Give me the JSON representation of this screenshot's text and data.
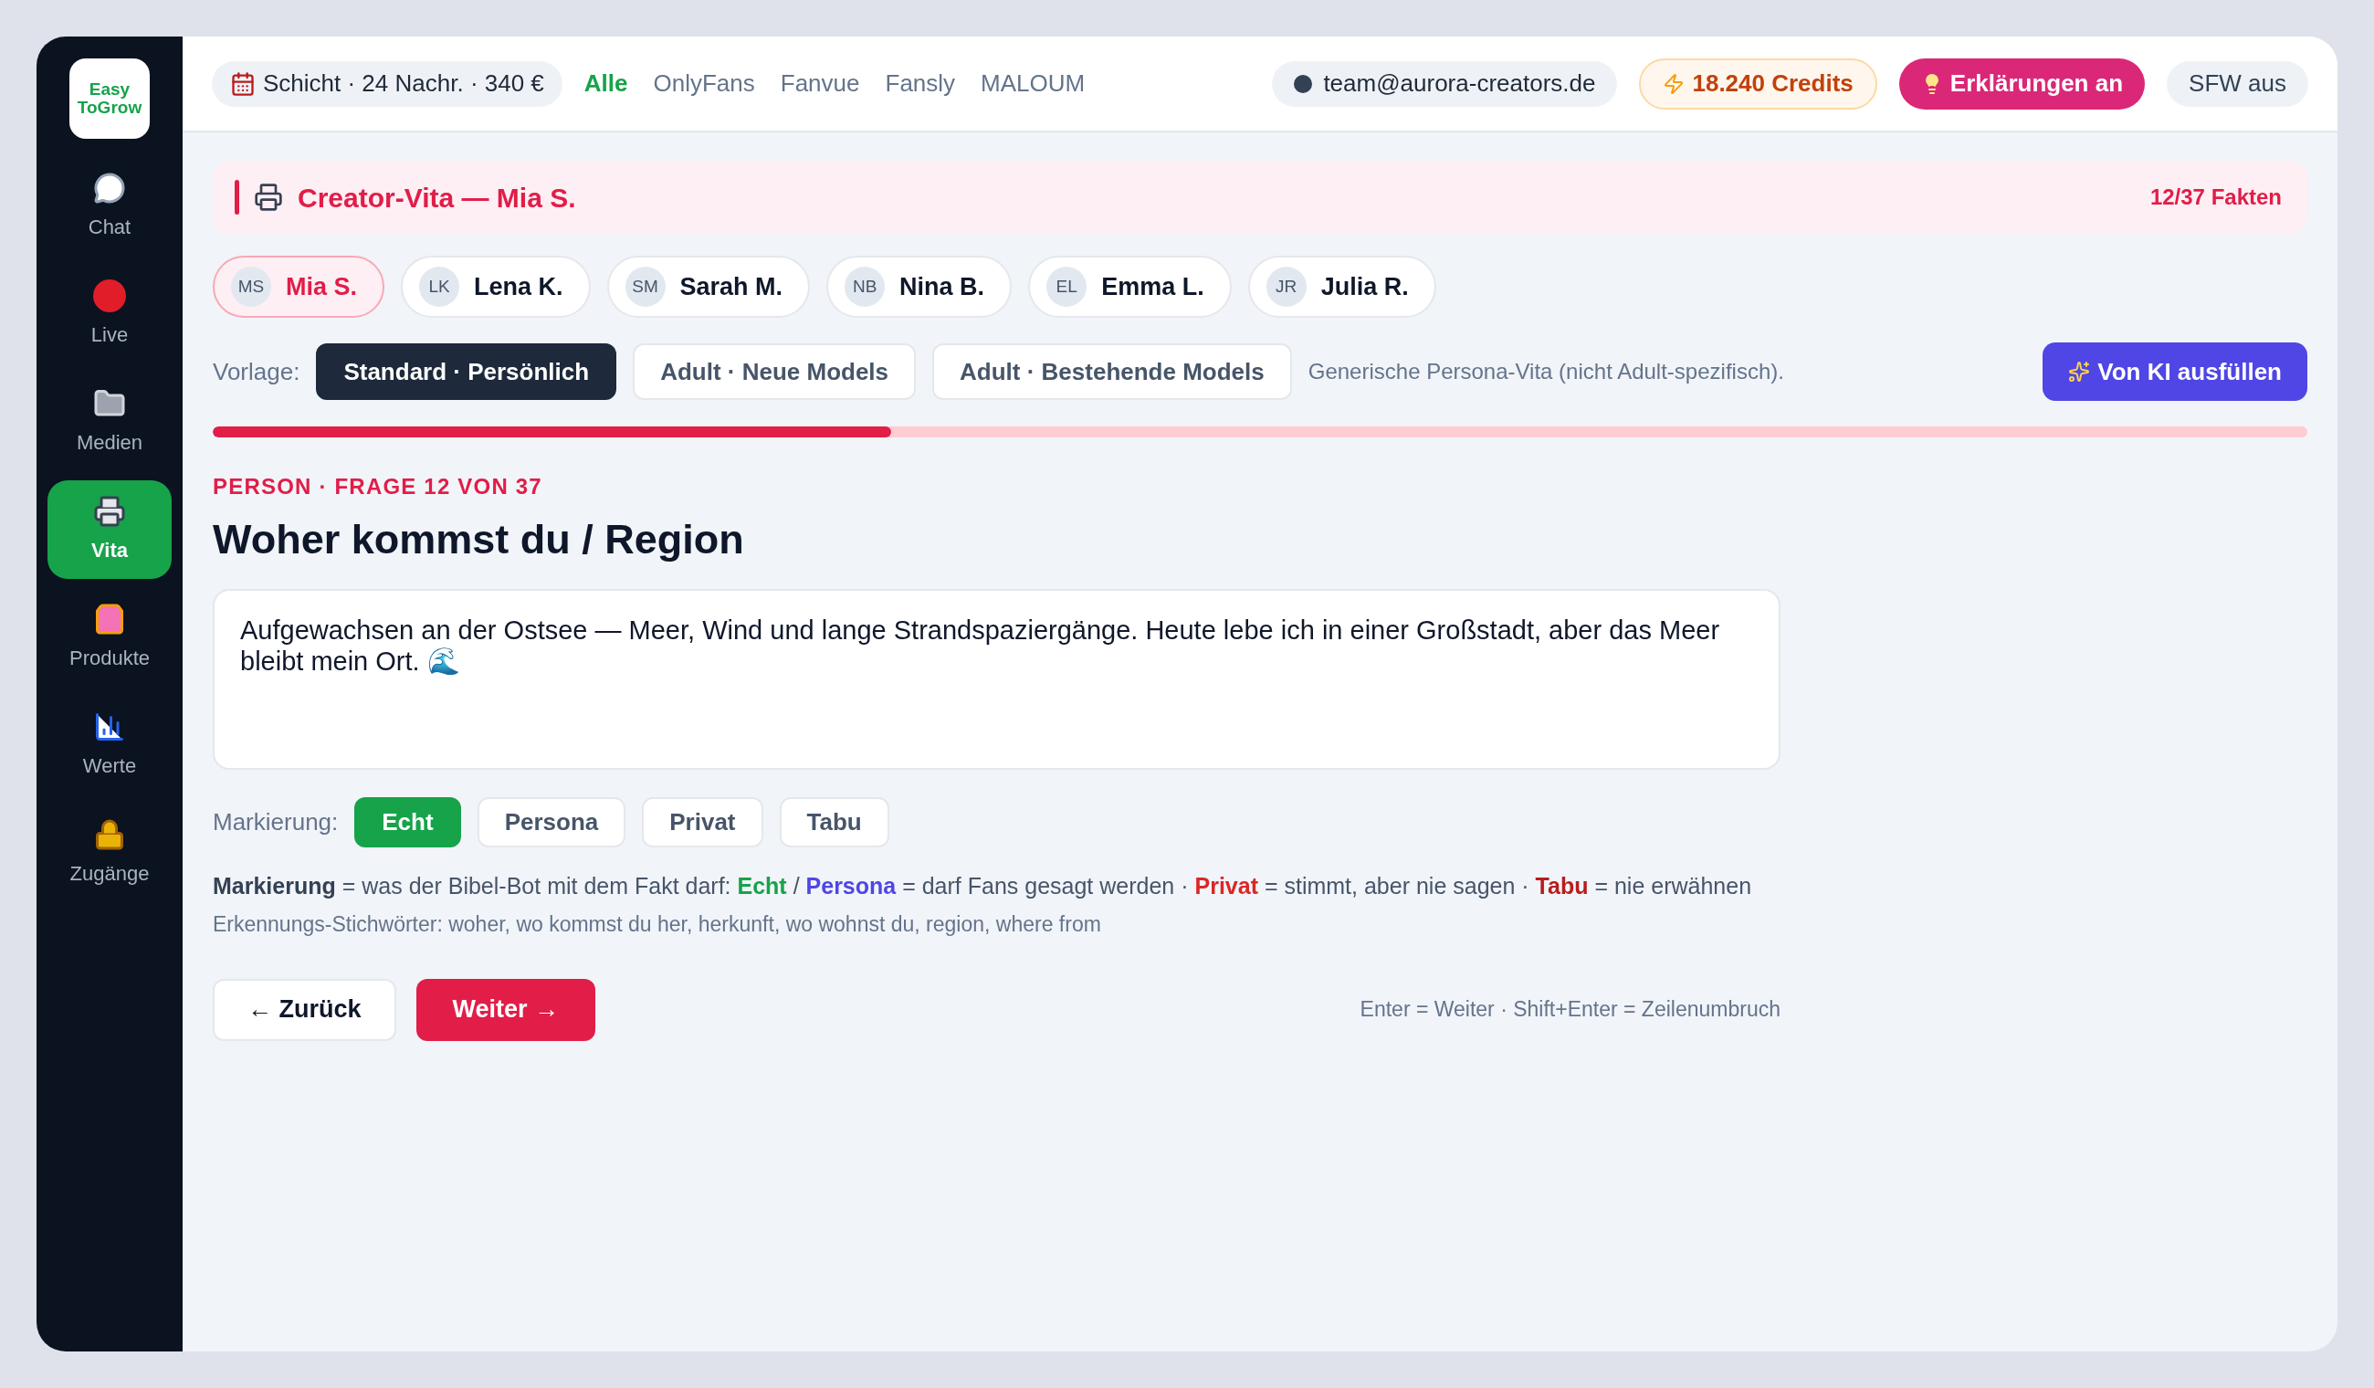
{
  "sidebar": {
    "logo": "Easy ToGrow",
    "items": [
      {
        "label": "Chat",
        "kind": "chat",
        "selected": false
      },
      {
        "label": "Live",
        "kind": "record",
        "selected": false
      },
      {
        "label": "Medien",
        "kind": "folder",
        "selected": false
      },
      {
        "label": "Vita",
        "kind": "printer",
        "selected": true
      },
      {
        "label": "Produkte",
        "kind": "bag",
        "selected": false
      },
      {
        "label": "Werte",
        "kind": "chart",
        "selected": false
      },
      {
        "label": "Zugänge",
        "kind": "lock",
        "selected": false
      }
    ]
  },
  "topbar": {
    "shift": "Schicht · 24 Nachr. · 340 €",
    "platforms": [
      {
        "label": "Alle",
        "selected": true
      },
      {
        "label": "OnlyFans",
        "selected": false
      },
      {
        "label": "Fanvue",
        "selected": false
      },
      {
        "label": "Fansly",
        "selected": false
      },
      {
        "label": "MALOUM",
        "selected": false
      }
    ],
    "account": "team@aurora-creators.de",
    "credits": "18.240 Credits",
    "explain_button": {
      "label": "Erklärungen an",
      "on": true
    },
    "sfw_button": "SFW aus"
  },
  "header": {
    "title": "Creator-Vita — Mia S.",
    "count": "12/37 Fakten"
  },
  "models": [
    {
      "initials": "MS",
      "name": "Mia S.",
      "selected": true
    },
    {
      "initials": "LK",
      "name": "Lena K.",
      "selected": false
    },
    {
      "initials": "SM",
      "name": "Sarah M.",
      "selected": false
    },
    {
      "initials": "NB",
      "name": "Nina B.",
      "selected": false
    },
    {
      "initials": "EL",
      "name": "Emma L.",
      "selected": false
    },
    {
      "initials": "JR",
      "name": "Julia R.",
      "selected": false
    }
  ],
  "template": {
    "label": "Vorlage:",
    "options": [
      {
        "label": "Standard · Persönlich",
        "selected": true
      },
      {
        "label": "Adult · Neue Models",
        "selected": false
      },
      {
        "label": "Adult · Bestehende Models",
        "selected": false
      }
    ],
    "description": "Generische Persona-Vita (nicht Adult-spezifisch).",
    "ai_button": "Von KI ausfüllen"
  },
  "progress": {
    "level": 0.324
  },
  "question": {
    "eyebrow": "PERSON · FRAGE 12 VON 37",
    "title": "Woher kommst du / Region",
    "answer": "Aufgewachsen an der Ostsee — Meer, Wind und lange Strandspaziergänge. Heute lebe ich in einer Großstadt, aber das Meer bleibt mein Ort. 🌊"
  },
  "marking": {
    "label": "Markierung:",
    "options": [
      {
        "label": "Echt",
        "selected": true
      },
      {
        "label": "Persona",
        "selected": false
      },
      {
        "label": "Privat",
        "selected": false
      },
      {
        "label": "Tabu",
        "selected": false
      }
    ],
    "legend": [
      {
        "text": "Markierung",
        "kind": "term",
        "color": "#334155"
      },
      {
        "text": " = was der Bibel-Bot mit dem Fakt darf: ",
        "kind": "plain"
      },
      {
        "text": "Echt",
        "kind": "term",
        "color": "#16a34a"
      },
      {
        "text": " / ",
        "kind": "plain"
      },
      {
        "text": "Persona",
        "kind": "term",
        "color": "#4f46e5"
      },
      {
        "text": " = darf Fans gesagt werden · ",
        "kind": "plain"
      },
      {
        "text": "Privat",
        "kind": "term",
        "color": "#dc2626"
      },
      {
        "text": " = stimmt, aber nie sagen · ",
        "kind": "plain"
      },
      {
        "text": "Tabu",
        "kind": "term",
        "color": "#b91c1c"
      },
      {
        "text": " = nie erwähnen",
        "kind": "plain"
      }
    ],
    "keywords": "Erkennungs-Stichwörter: woher, wo kommst du her, herkunft, wo wohnst du, region, where from"
  },
  "navigation": {
    "back": "← Zurück",
    "next": "Weiter →",
    "hint": "Enter = Weiter · Shift+Enter = Zeilenumbruch"
  }
}
